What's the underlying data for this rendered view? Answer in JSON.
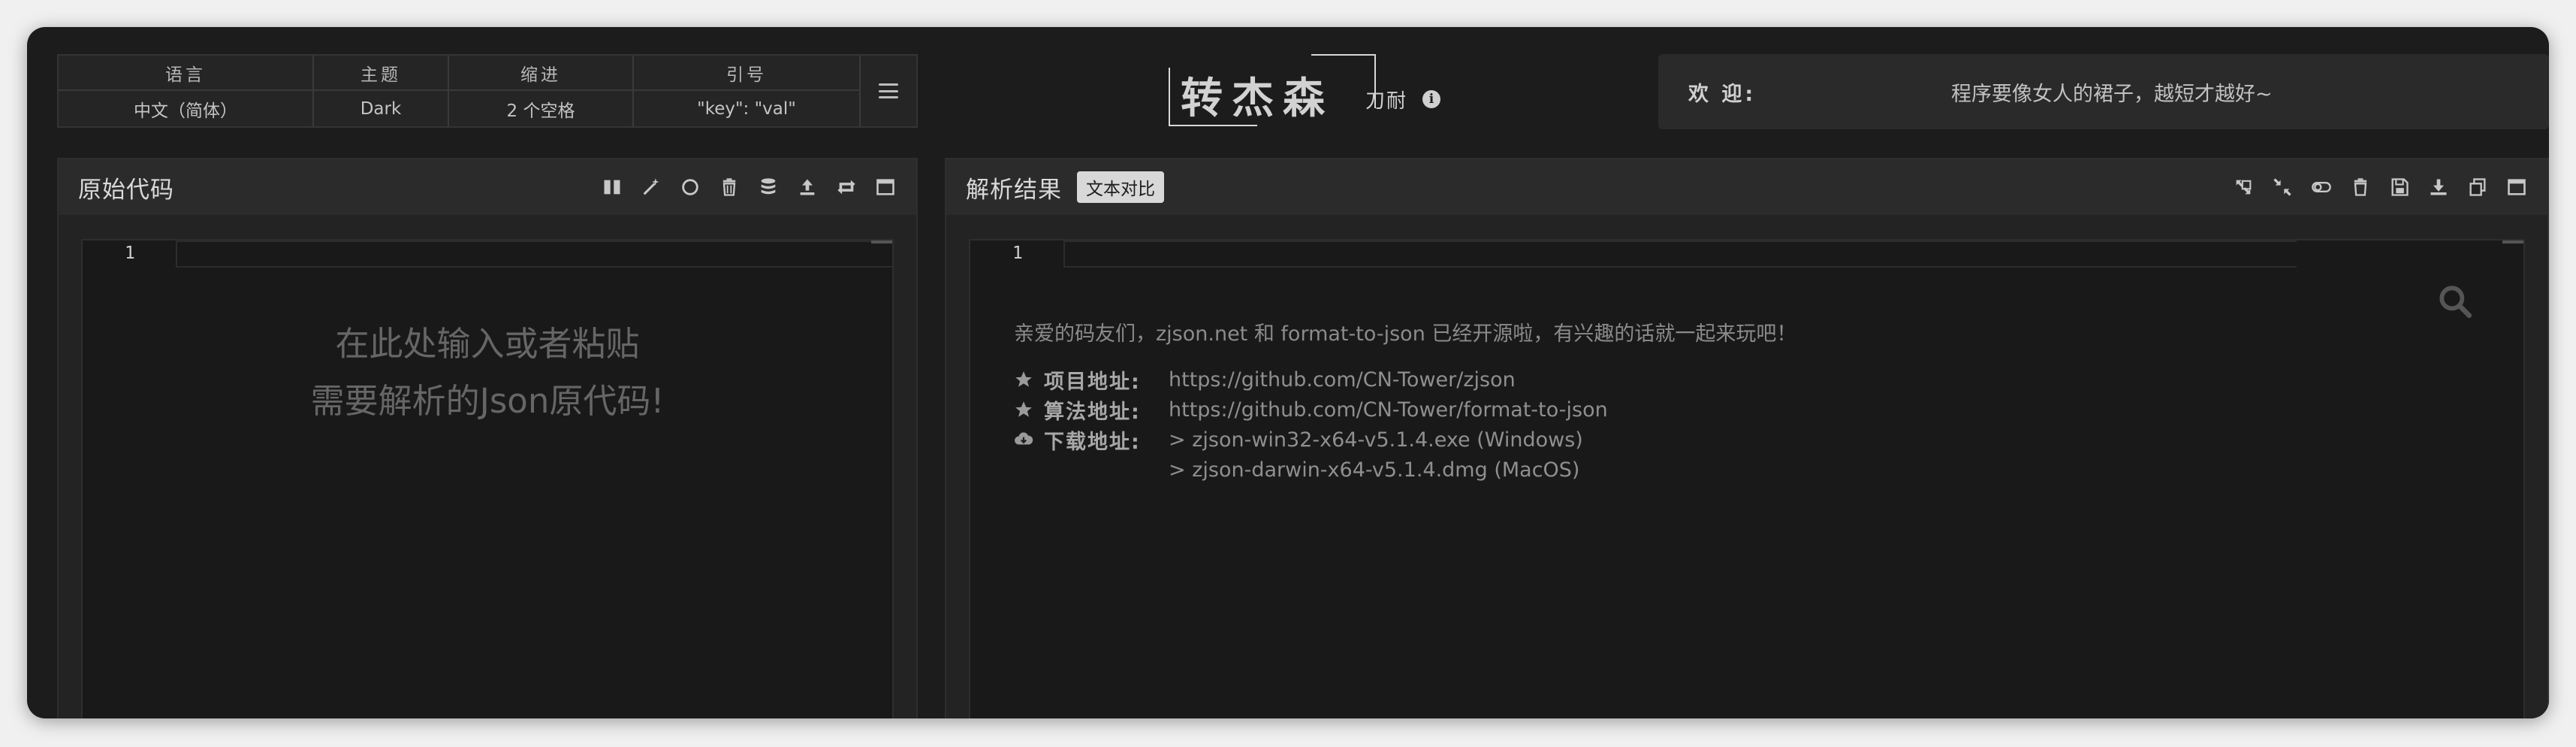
{
  "settings": {
    "headers": [
      "语言",
      "主题",
      "缩进",
      "引号"
    ],
    "values": [
      "中文（简体）",
      "Dark",
      "2 个空格",
      "\"key\": \"val\""
    ]
  },
  "logo": {
    "main": "转杰森",
    "sub": "刀耐",
    "info_glyph": "i"
  },
  "welcome": {
    "label": "欢 迎:",
    "message": "程序要像女人的裙子，越短才越好~"
  },
  "left_panel": {
    "title": "原始代码",
    "line_number": "1",
    "placeholder_line1": "在此处输入或者粘贴",
    "placeholder_line2": "需要解析的Json原代码!"
  },
  "right_panel": {
    "title": "解析结果",
    "compare_label": "文本对比",
    "line_number": "1",
    "intro": "亲爱的码友们，zjson.net 和 format-to-json 已经开源啦，有兴趣的话就一起来玩吧！",
    "project_label": "项目地址:",
    "project_url": "https://github.com/CN-Tower/zjson",
    "algo_label": "算法地址:",
    "algo_url": "https://github.com/CN-Tower/format-to-json",
    "download_label": "下载地址:",
    "download_win": "> zjson-win32-x64-v5.1.4.exe (Windows)",
    "download_mac": "> zjson-darwin-x64-v5.1.4.dmg (MacOS)"
  },
  "colors": {
    "background": "#1c1c1c",
    "panel": "#232323",
    "header": "#2b2b2b",
    "text": "#d0d0d0"
  }
}
